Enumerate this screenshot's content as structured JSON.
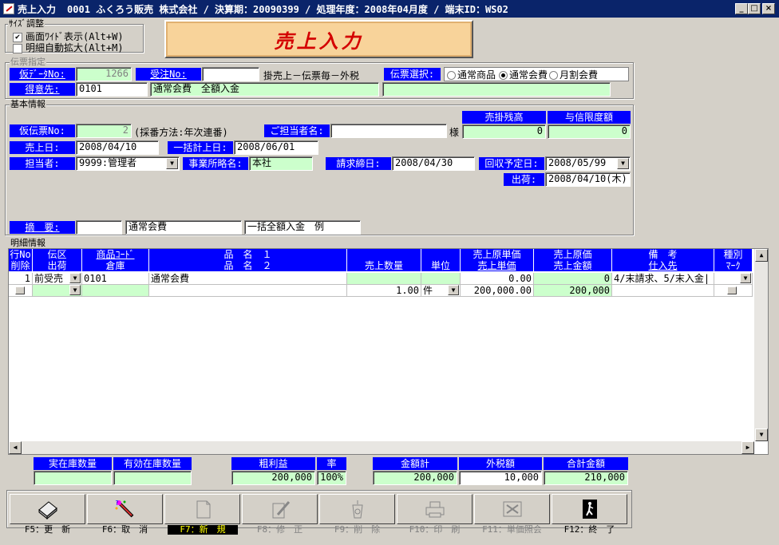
{
  "window": {
    "title": "売上入力",
    "title_info": "0001 ふくろう販売 株式会社 / 決算期：20090399 / 処理年度：2008年04月度 / 端末ID：WS02",
    "min": "_",
    "max": "□",
    "close": "×"
  },
  "size_adjust": {
    "legend": "ｻｲｽﾞ調整",
    "opt1": "画面ﾜｲﾄﾞ表示(Alt+W)",
    "opt1_checked": "✔",
    "opt2": "明細自動拡大(Alt+M)"
  },
  "banner": "売上入力",
  "slip": {
    "legend": "伝票指定",
    "kari_data_label": "仮ﾃﾞｰﾀNo:",
    "kari_data_value": "1266",
    "juchu_label": "受注No:",
    "juchu_value": "",
    "kake_text": "掛売上－伝票毎－外税",
    "select_label": "伝票選択:",
    "radio1": "通常商品",
    "radio2": "通常会費",
    "radio3": "月割会費",
    "customer_label": "得意先:",
    "customer_code": "0101",
    "customer_name": "通常会費　全額入金",
    "customer_extra": ""
  },
  "basic": {
    "legend": "基本情報",
    "ar_balance_label": "売掛残高",
    "credit_limit_label": "与信限度額",
    "ar_balance": "0",
    "credit_limit": "0",
    "kari_slip_label": "仮伝票No:",
    "kari_slip_value": "2",
    "numbering": "(採番方法:年次連番)",
    "contact_label": "ご担当者名:",
    "contact_value": "",
    "sama": "様",
    "sales_date_label": "売上日:",
    "sales_date": "2008/04/10",
    "bulk_date_label": "一括計上日:",
    "bulk_date": "2008/06/01",
    "staff_label": "担当者:",
    "staff_value": "9999:管理者",
    "office_label": "事業所略名:",
    "office_value": "本社",
    "closing_label": "請求締日:",
    "closing_value": "2008/04/30",
    "collect_label": "回収予定日:",
    "collect_value": "2008/05/99",
    "ship_label": "出荷:",
    "ship_value": "2008/04/10(木)",
    "memo_label": "摘　要:",
    "memo1": "",
    "memo2": "通常会費",
    "memo3": "一括全額入金　例"
  },
  "detail": {
    "legend": "明細情報",
    "h1": [
      "行No",
      "伝区",
      "商品ｺｰﾄﾞ",
      "品　名　１",
      "",
      "",
      "売上原単価",
      "売上原価",
      "備　考",
      "種別"
    ],
    "h2": [
      "削除",
      "出荷",
      "倉庫",
      "品　名　２",
      "売上数量",
      "単位",
      "売上単価",
      "売上金額",
      "仕入先",
      "ﾏｰｸ"
    ],
    "row1": {
      "no": "1",
      "kubun": "前受売",
      "code": "0101",
      "name1": "通常会費",
      "unit_cost": "0.00",
      "cost": "0",
      "note": "4/末請求、5/末入金|"
    },
    "row2": {
      "qty": "1.00",
      "unit": "件",
      "price": "200,000.00",
      "amount": "200,000"
    }
  },
  "summary": {
    "stock_label": "実在庫数量",
    "eff_stock_label": "有効在庫数量",
    "stock": "",
    "eff_stock": "",
    "gross_label": "粗利益",
    "rate_label": "率",
    "gross": "200,000",
    "rate": "100%",
    "amount_label": "金額計",
    "tax_label": "外税額",
    "total_label": "合計金額",
    "amount": "200,000",
    "tax": "10,000",
    "total": "210,000"
  },
  "fkeys": [
    {
      "label": "F5：更　新"
    },
    {
      "label": "F6：取　消"
    },
    {
      "label": "F7：新　規"
    },
    {
      "label": "F8：修　正"
    },
    {
      "label": "F9：削　除"
    },
    {
      "label": "F10：印　刷"
    },
    {
      "label": "F11：単価照会"
    },
    {
      "label": "F12：終　了"
    }
  ]
}
